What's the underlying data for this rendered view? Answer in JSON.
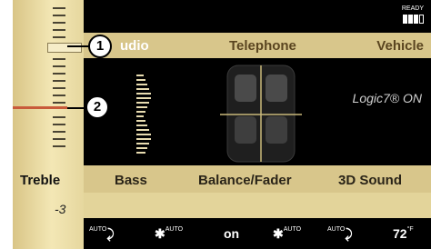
{
  "status": {
    "ready_label": "READY"
  },
  "menu": {
    "audio": "Audio",
    "audio_visible": "udio",
    "telephone": "Telephone",
    "vehicle": "Vehicle"
  },
  "logic": "Logic7® ON",
  "treble": {
    "label": "Treble",
    "value": "-3"
  },
  "bottom_menu": {
    "bass": "Bass",
    "balance": "Balance/Fader",
    "sound3d": "3D Sound"
  },
  "climate": {
    "left_auto": "AUTO",
    "fan_auto_left": "AUTO",
    "on": "on",
    "fan_auto_right": "AUTO",
    "right_auto": "AUTO",
    "temperature": "72",
    "temperature_unit": "°F"
  },
  "callouts": {
    "one": "1",
    "two": "2"
  }
}
